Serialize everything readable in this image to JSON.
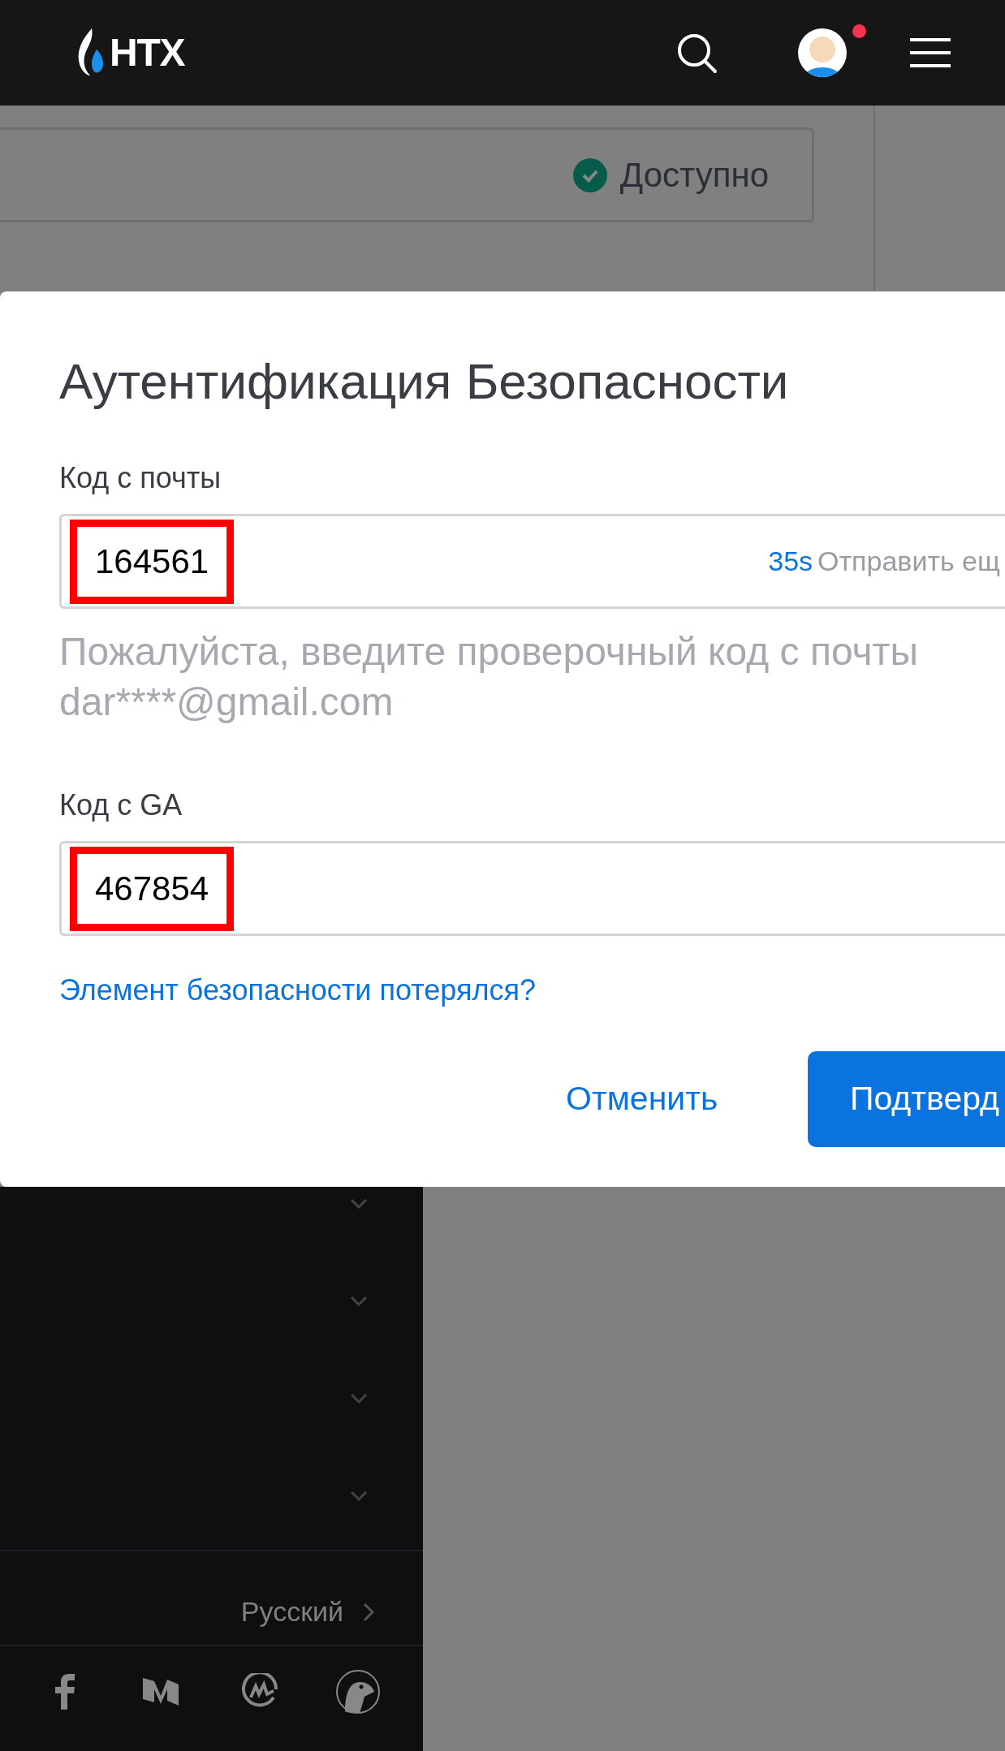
{
  "header": {
    "logo": "HTX",
    "notification_dot": true
  },
  "status": {
    "label": "Доступно"
  },
  "dialog": {
    "title": "Аутентификация Безопасности",
    "fields": [
      {
        "label": "Код с почты",
        "value": "164561",
        "highlighted": true,
        "countdown": "35s",
        "resend": "Отправить ещ",
        "hint": "Пожалуйста, введите проверочный код с почты dar****@gmail.com"
      },
      {
        "label": "Код с GA",
        "value": "467854",
        "highlighted": true
      }
    ],
    "link": "Элемент безопасности потерялся?",
    "cancel": "Отменить",
    "confirm": "Подтверд"
  },
  "footer": {
    "menu_rows": [
      {
        "expanded": false
      },
      {
        "expanded": false
      },
      {
        "expanded": false
      },
      {
        "expanded": false
      }
    ],
    "language": "Русский",
    "socials": [
      {
        "kind": "facebook"
      },
      {
        "kind": "medium"
      },
      {
        "kind": "coinmarketcap"
      },
      {
        "kind": "coingecko"
      }
    ]
  }
}
